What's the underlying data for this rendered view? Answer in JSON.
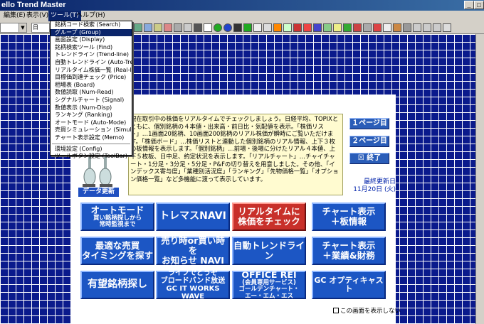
{
  "window": {
    "title": "ello Trend Master"
  },
  "menubar": {
    "items": [
      {
        "label": "編集(E)"
      },
      {
        "label": "表示(V)"
      },
      {
        "label": "ツール(T)"
      },
      {
        "label": "ヘルプ(H)"
      }
    ]
  },
  "toolbar": {
    "combo2_value": "日"
  },
  "dropdown": {
    "group1": [
      "銘柄コード検索 (Search)",
      "グループ (Group)",
      "画面設定 (Display)",
      "銘柄検索ツール (Find)",
      "トレンドライン (Trend-line)",
      "自動トレンドライン (Auto-Trend)",
      "リアルタイム株価一覧 (Real-Ita)",
      "目標価到達チェック (Price)",
      "相場表 (Board)",
      "数値読取 (Num-Read)",
      "シグナルチャート (Signal)",
      "数値表示 (Num-Disp)",
      "ランキング (Ranking)",
      "オートモード (Auto-Mode)",
      "売買シミュレーション (Simulation)",
      "チャート表示設定 (Memo)"
    ],
    "group2": [
      "環境設定 (Config)",
      "ツールボタン設定 (ToolBar)"
    ]
  },
  "intro": {
    "text": "現在取引中の株価をリアルタイムでチェックしましょう。日経平均、TOPIXとともに、個別銘柄の４本値・出来高・前日比・気配値を表示。「株価リスト」…1画面20銘柄、10画面200銘柄のリアル株価が瞬時にご覧いただけます。「株価ボード」…株価リストと連動した個別銘柄のリアル情報、上下３枚の板情報を表示します。「個別銘柄」…前場・後場に分けたリアル４本値、上下５枚板、日中足、約定状況を表示します。「リアルチャート」…チャイチャート・1分足・3分足・5分足・P&Fの切り替えを用意しました。その他、「インデックス寄与度」「業種別活況度」「ランキング」「先物価格一覧」「オプション価格一覧」など多機能に渡って表示しています。"
  },
  "page_buttons": {
    "page1": "１ページ目",
    "page2": "２ページ目",
    "end": "☒ 終了"
  },
  "update": {
    "label": "最終更新日",
    "date": "11月20日 (火)"
  },
  "data_update": "データ更新",
  "tiles": {
    "auto_mode": {
      "line1": "オートモード",
      "line2": "買い銘柄探しから",
      "line3": "常時監視まで"
    },
    "tremas": {
      "line1": "トレマスNAVI"
    },
    "realtime": {
      "line1": "リアルタイムに",
      "line2": "株価をチェック"
    },
    "chart_board": {
      "line1": "チャート表示",
      "line2": "＋板情報"
    },
    "timing": {
      "line1": "最適な売買",
      "line2": "タイミングを探す"
    },
    "buysell": {
      "line1": "売り時or買い時を",
      "line2": "お知らせ NAVI"
    },
    "auto_trend": {
      "line1": "自動トレンドライン"
    },
    "chart_perf": {
      "line1": "チャート表示",
      "line2": "＋業績&財務"
    },
    "promising": {
      "line1": "有望銘柄探し"
    },
    "live": {
      "line1": "ライブでどうぞ",
      "line2": "ブロードバンド放送",
      "line3": "GC IT WORKS WAVE"
    },
    "office": {
      "line1": "OFFICE REI",
      "line2": "(会員専用サービス)",
      "line3": "ゴールデンチャート・",
      "line4": "エー・エム・エス"
    },
    "gc_opti": {
      "line1": "GC オプティキャスト"
    }
  },
  "no_show": "この画面を表示しない"
}
